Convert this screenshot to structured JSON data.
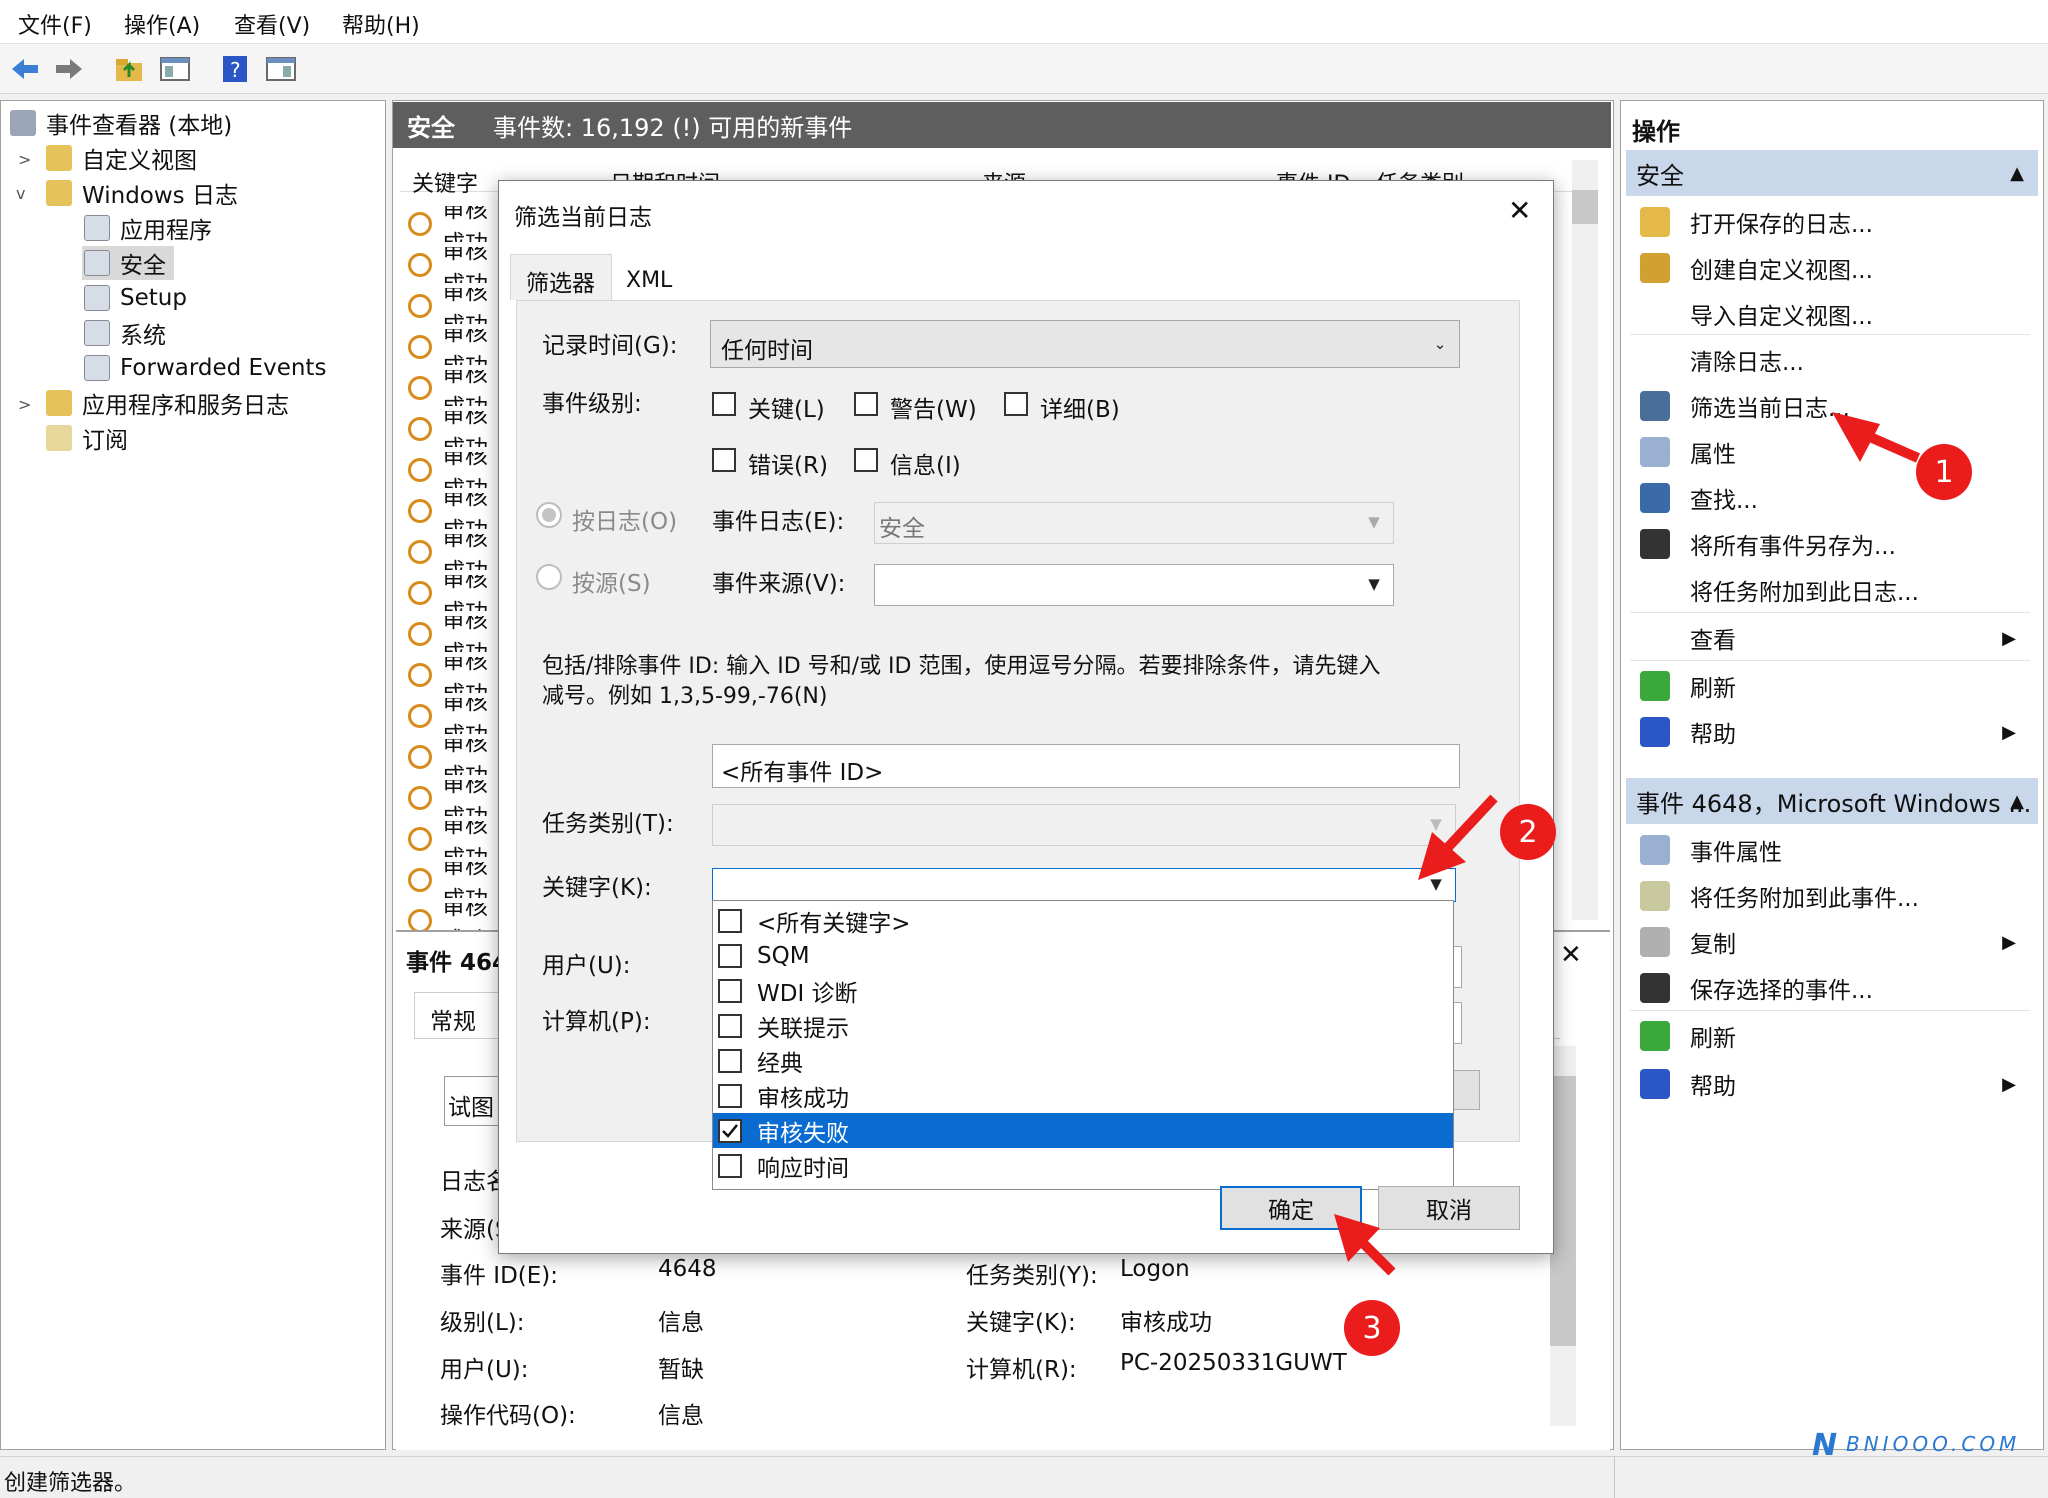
{
  "menubar": {
    "items": [
      "文件(F)",
      "操作(A)",
      "查看(V)",
      "帮助(H)"
    ]
  },
  "tree": {
    "root": "事件查看器 (本地)",
    "items": [
      "自定义视图",
      "Windows 日志",
      "应用程序",
      "安全",
      "Setup",
      "系统",
      "Forwarded Events",
      "应用程序和服务日志",
      "订阅"
    ]
  },
  "center": {
    "title": "安全",
    "subtitle": "事件数: 16,192 (!) 可用的新事件",
    "columns": [
      "关键字",
      "日期和时间",
      "来源",
      "事件 ID",
      "任务类别"
    ],
    "row_label": "审核成功",
    "details_title": "事件 4648",
    "details_tab": "常规",
    "details_snippet": "试图",
    "details": {
      "log_name_label": "日志名",
      "source_label": "来源(S",
      "event_id_label": "事件 ID(E):",
      "event_id": "4648",
      "task_label": "任务类别(Y):",
      "task": "Logon",
      "level_label": "级别(L):",
      "level": "信息",
      "keyword_label": "关键字(K):",
      "keyword": "审核成功",
      "user_label": "用户(U):",
      "user": "暂缺",
      "computer_label": "计算机(R):",
      "computer": "PC-20250331GUWT",
      "opcode_label": "操作代码(O):",
      "opcode": "信息"
    }
  },
  "dialog": {
    "title": "筛选当前日志",
    "tabs": [
      "筛选器",
      "XML"
    ],
    "logged_label": "记录时间(G):",
    "logged_value": "任何时间",
    "level_label": "事件级别:",
    "levels": [
      "关键(L)",
      "警告(W)",
      "详细(B)",
      "错误(R)",
      "信息(I)"
    ],
    "by_log": "按日志(O)",
    "by_source": "按源(S)",
    "event_log_label": "事件日志(E):",
    "event_log_value": "安全",
    "event_source_label": "事件来源(V):",
    "help_text_1": "包括/排除事件 ID: 输入 ID 号和/或 ID 范围，使用逗号分隔。若要排除条件，请先键入",
    "help_text_2": "减号。例如 1,3,5-99,-76(N)",
    "event_id_value": "<所有事件 ID>",
    "task_label": "任务类别(T):",
    "keyword_label": "关键字(K):",
    "user_label": "用户(U):",
    "computer_label": "计算机(P):",
    "keywords": [
      "<所有关键字>",
      "SQM",
      "WDI 诊断",
      "关联提示",
      "经典",
      "审核成功",
      "审核失败",
      "响应时间"
    ],
    "selected_keyword": "审核失败",
    "ok": "确定",
    "cancel": "取消"
  },
  "actions": {
    "header": "操作",
    "section1": "安全",
    "items1": [
      "打开保存的日志...",
      "创建自定义视图...",
      "导入自定义视图...",
      "清除日志...",
      "筛选当前日志...",
      "属性",
      "查找...",
      "将所有事件另存为...",
      "将任务附加到此日志...",
      "查看",
      "刷新",
      "帮助"
    ],
    "section2": "事件 4648，Microsoft Windows ...",
    "items2": [
      "事件属性",
      "将任务附加到此事件...",
      "复制",
      "保存选择的事件...",
      "刷新",
      "帮助"
    ]
  },
  "annotations": [
    "1",
    "2",
    "3"
  ],
  "watermark": "BNIOOO.COM",
  "status": "创建筛选器。",
  "colors": {
    "accent": "#0a6bd1",
    "header": "#5e5e5e",
    "section": "#c9d7ea",
    "annotation": "#ea1c1c"
  }
}
